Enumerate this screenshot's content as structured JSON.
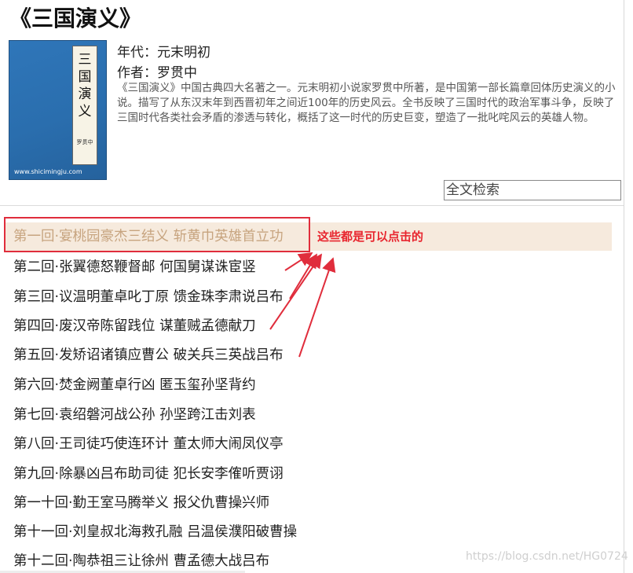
{
  "book": {
    "title": "《三国演义》",
    "cover": {
      "label_text": "三国演义",
      "label_author": "罗贯中",
      "site_text": "www.shicimingju.com",
      "background_color": "#2f76b9"
    },
    "era_line": "年代：元末明初",
    "author_line": "作者：罗贯中",
    "description": "《三国演义》中国古典四大名著之一。元末明初小说家罗贯中所著，是中国第一部长篇章回体历史演义的小说。描写了从东汉末年到西晋初年之间近100年的历史风云。全书反映了三国时代的政治军事斗争，反映了三国时代各类社会矛盾的渗透与转化，概括了这一时代的历史巨变，塑造了一批叱咤风云的英雄人物。"
  },
  "search": {
    "placeholder": "全文检索"
  },
  "chapters": [
    "第一回·宴桃园豪杰三结义 斩黄巾英雄首立功",
    "第二回·张翼德怒鞭督邮 何国舅谋诛宦竖",
    "第三回·议温明董卓叱丁原 馈金珠李肃说吕布",
    "第四回·废汉帝陈留践位 谋董贼孟德献刀",
    "第五回·发矫诏诸镇应曹公 破关兵三英战吕布",
    "第六回·焚金阙董卓行凶 匿玉玺孙坚背约",
    "第七回·袁绍磐河战公孙 孙坚跨江击刘表",
    "第八回·王司徒巧使连环计 董太师大闹凤仪亭",
    "第九回·除暴凶吕布助司徒 犯长安李傕听贾诩",
    "第一十回·勤王室马腾举义 报父仇曹操兴师",
    "第十一回·刘皇叔北海救孔融 吕温侯濮阳破曹操",
    "第十二回·陶恭祖三让徐州 曹孟德大战吕布"
  ],
  "annotation": {
    "text": "这些都是可以点击的",
    "color": "#e8262f"
  },
  "colors": {
    "highlight_background": "#f6eadd",
    "highlight_text": "#c7a47f",
    "annotation_red": "#e02d3c"
  },
  "watermark": "https://blog.csdn.net/HG0724"
}
